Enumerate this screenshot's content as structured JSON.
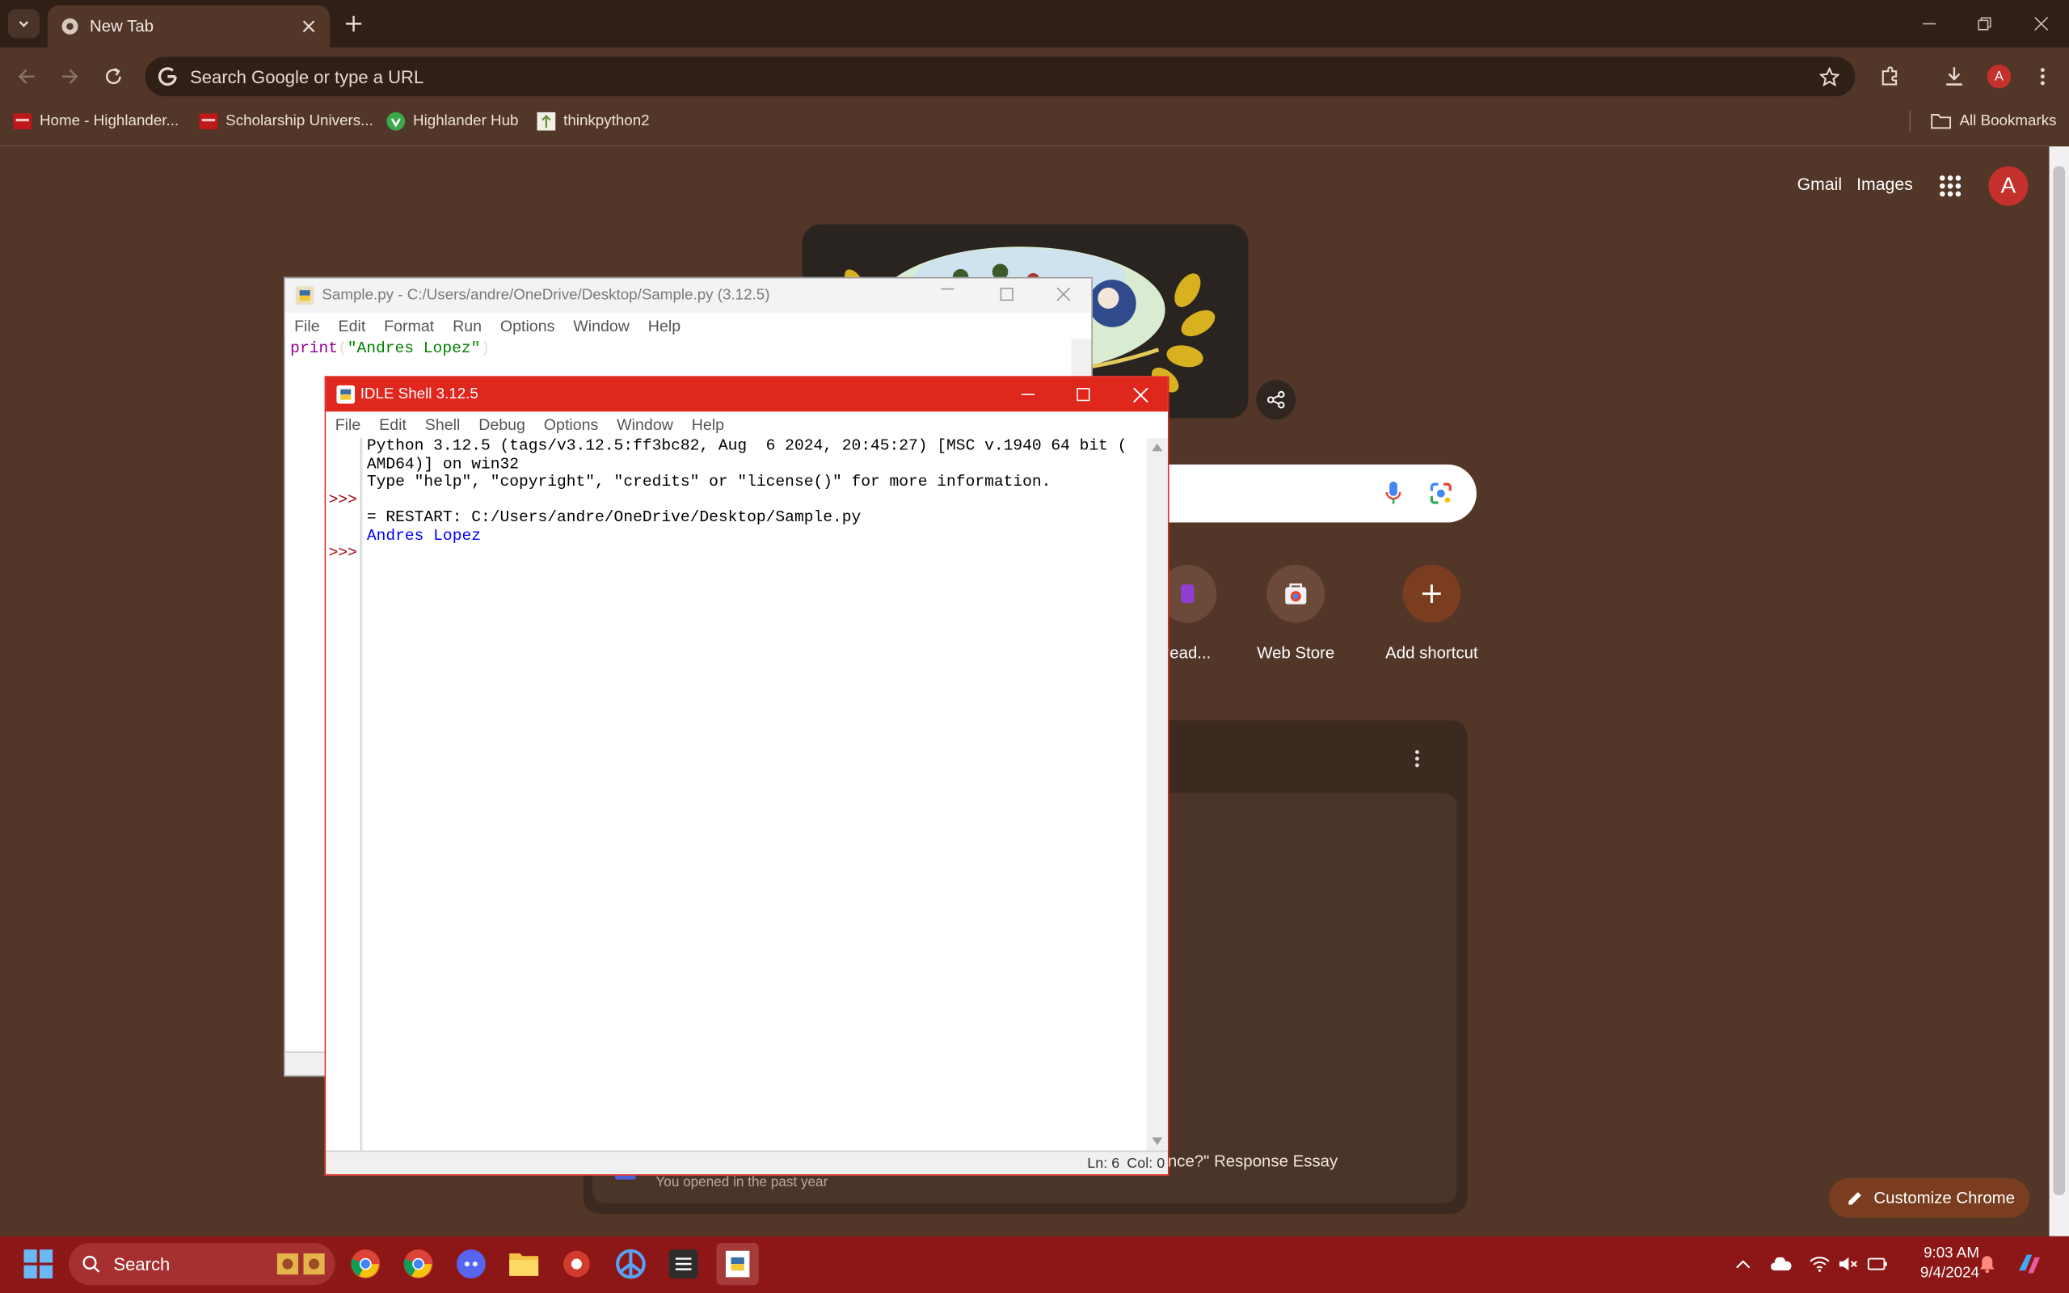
{
  "browser": {
    "tab_title": "New Tab",
    "omnibox_placeholder": "Search Google or type a URL",
    "bookmarks": [
      "Home - Highlander...",
      "Scholarship Univers...",
      "Highlander Hub",
      "thinkpython2"
    ],
    "all_bookmarks": "All Bookmarks",
    "profile_initial": "A"
  },
  "ntp": {
    "links": [
      "Gmail",
      "Images"
    ],
    "profile_initial": "A",
    "shortcuts": [
      "read...",
      "Web Store",
      "Add shortcut"
    ],
    "card_item_title": "nce?\" Response Essay",
    "card_item_sub": "You opened in the past year",
    "customize_label": "Customize Chrome"
  },
  "editor": {
    "title": "Sample.py - C:/Users/andre/OneDrive/Desktop/Sample.py (3.12.5)",
    "menu": [
      "File",
      "Edit",
      "Format",
      "Run",
      "Options",
      "Window",
      "Help"
    ],
    "code_fn": "print",
    "code_open": "(",
    "code_str": "\"Andres Lopez\"",
    "code_close": ")"
  },
  "shell": {
    "title": "IDLE Shell 3.12.5",
    "menu": [
      "File",
      "Edit",
      "Shell",
      "Debug",
      "Options",
      "Window",
      "Help"
    ],
    "lines": [
      "Python 3.12.5 (tags/v3.12.5:ff3bc82, Aug  6 2024, 20:45:27) [MSC v.1940 64 bit (",
      "AMD64)] on win32",
      "Type \"help\", \"copyright\", \"credits\" or \"license()\" for more information.",
      "= RESTART: C:/Users/andre/OneDrive/Desktop/Sample.py",
      "Andres Lopez"
    ],
    "prompt": ">>>",
    "status_ln": "Ln: 6",
    "status_col": "Col: 0"
  },
  "taskbar": {
    "search_label": "Search",
    "time": "9:03 AM",
    "date": "9/4/2024"
  },
  "colors": {
    "chrome_bg": "#523628",
    "shell_title": "#e0271e",
    "taskbar": "#8d1616",
    "idle_string": "#008000",
    "idle_builtin": "#900090",
    "idle_output": "#0000ff",
    "idle_prompt": "#a0000a"
  }
}
